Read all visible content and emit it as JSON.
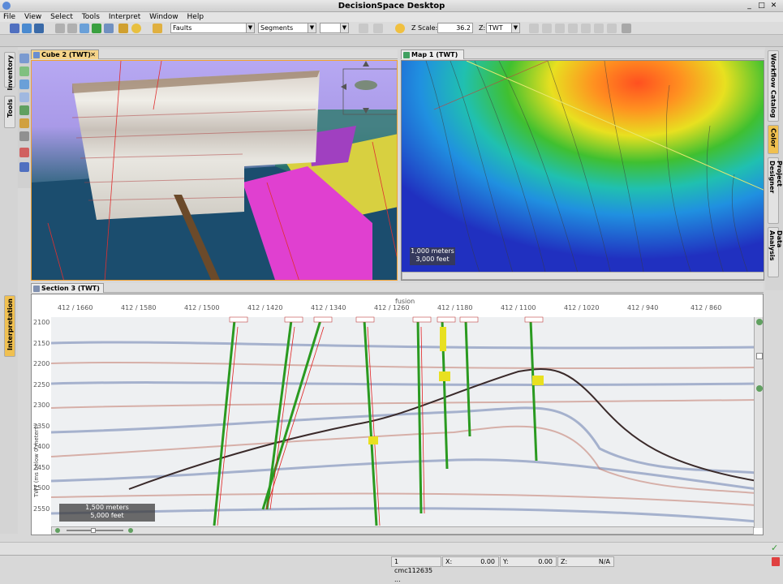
{
  "app": {
    "title": "DecisionSpace Desktop"
  },
  "menu": [
    "File",
    "View",
    "Select",
    "Tools",
    "Interpret",
    "Window",
    "Help"
  ],
  "toolbar": {
    "faults": "Faults",
    "segments": "Segments",
    "zscale_label": "Z Scale:",
    "zscale_value": "36.2",
    "z_label": "Z:",
    "z_value": "TWT"
  },
  "left_tabs": [
    "Inventory",
    "Tools",
    "Interpretation"
  ],
  "right_tabs": [
    "Workflow Catalog",
    "Color",
    "Project Designer",
    "Data Analysis"
  ],
  "views": {
    "cube_title": "Cube 2 (TWT)",
    "map_title": "Map 1 (TWT)",
    "section_title": "Section 3 (TWT)",
    "map_scale": [
      "1,000 meters",
      "3,000 feet"
    ],
    "section_scale": [
      "1,500 meters",
      "5,000 feet"
    ],
    "section_ylabel": "TWT (ms below 0 meters)",
    "section_marker": "fusion",
    "section_xticks": [
      "412 / 1660",
      "412 / 1580",
      "412 / 1500",
      "412 / 1420",
      "412 / 1340",
      "412 / 1260",
      "412 / 1180",
      "412 / 1100",
      "412 / 1020",
      "412 / 940",
      "412 / 860"
    ],
    "section_yticks": [
      "2100",
      "2150",
      "2200",
      "2250",
      "2300",
      "2350",
      "2400",
      "2450",
      "2500",
      "2550"
    ]
  },
  "status": {
    "ident": "1 cmc112635 ...",
    "x_label": "X:",
    "x_value": "0.00",
    "y_label": "Y:",
    "y_value": "0.00",
    "z_label": "Z:",
    "z_value": "N/A"
  },
  "colors": {
    "accent": "#f0a030",
    "sky": "#a99ae8",
    "wells": "#2a9a20"
  }
}
